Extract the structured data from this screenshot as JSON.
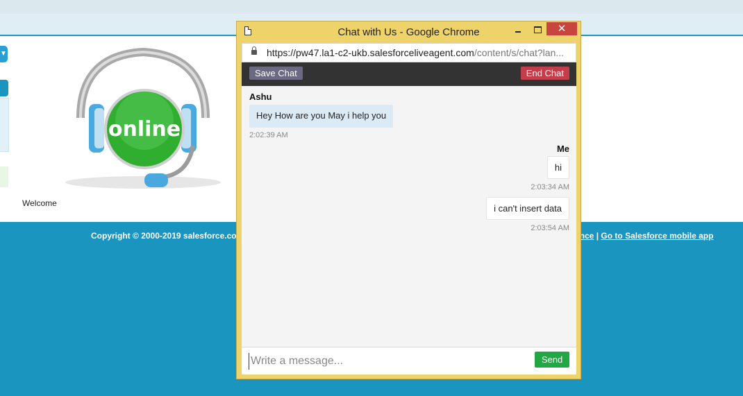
{
  "page": {
    "welcome": "Welcome",
    "logo_text": "online",
    "copyright": "Copyright © 2000-2019 salesforce.com",
    "footer_link_partial": "ance",
    "footer_separator": "|",
    "footer_link_mobile": "Go to Salesforce mobile app",
    "colors": {
      "background": "#1a95c0",
      "logo_green": "#2fae2f"
    }
  },
  "window": {
    "title": "Chat with Us - Google Chrome",
    "close_glyph": "✕",
    "url_host": "https://pw47.la1-c2-ukb.salesforceliveagent.com",
    "url_path": "/content/s/chat?lan...",
    "icons": {
      "page": "document-icon",
      "lock": "lock-icon"
    }
  },
  "chat": {
    "save_label": "Save Chat",
    "end_label": "End Chat",
    "agent_name": "Ashu",
    "me_name": "Me",
    "messages": [
      {
        "from": "agent",
        "text": "Hey How are you May i help you",
        "time": "2:02:39 AM"
      },
      {
        "from": "me",
        "text": "hi",
        "time": "2:03:34 AM"
      },
      {
        "from": "me",
        "text": "i can't insert data",
        "time": "2:03:54 AM"
      }
    ],
    "input_placeholder": "Write a message...",
    "send_label": "Send",
    "colors": {
      "save": "#6b6a82",
      "end": "#c43d4b",
      "send": "#22a745"
    }
  }
}
